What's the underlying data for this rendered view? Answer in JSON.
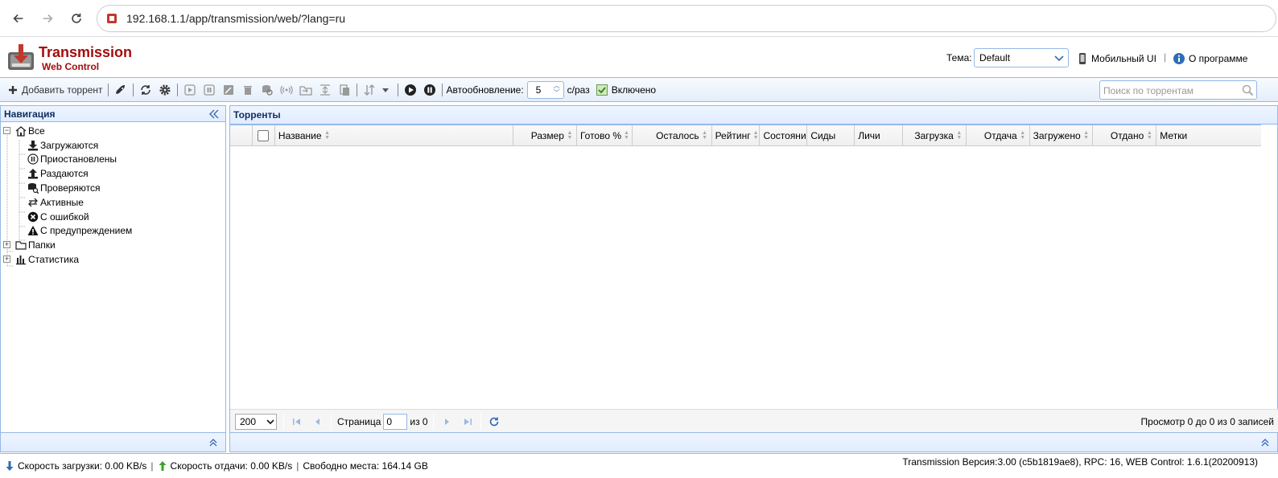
{
  "browser": {
    "url": "192.168.1.1/app/transmission/web/?lang=ru"
  },
  "header": {
    "title": "Transmission",
    "subtitle": "Web Control",
    "theme_label": "Тема:",
    "theme_value": "Default",
    "mobile_label": "Мобильный UI",
    "about_label": "О программе"
  },
  "toolbar": {
    "add_label": "Добавить торрент",
    "autorefresh_label": "Автообновление:",
    "autorefresh_value": "5",
    "autorefresh_unit": "с/раз",
    "enabled_label": "Включено",
    "search_placeholder": "Поиск по торрентам"
  },
  "nav": {
    "title": "Навигация",
    "items": [
      {
        "label": "Все",
        "icon": "home-icon"
      },
      {
        "label": "Загружаются",
        "icon": "download-icon"
      },
      {
        "label": "Приостановлены",
        "icon": "pause-circle-icon"
      },
      {
        "label": "Раздаются",
        "icon": "upload-icon"
      },
      {
        "label": "Проверяются",
        "icon": "database-search-icon"
      },
      {
        "label": "Активные",
        "icon": "arrows-exchange-icon"
      },
      {
        "label": "С ошибкой",
        "icon": "error-circle-icon"
      },
      {
        "label": "С предупреждением",
        "icon": "warning-icon"
      },
      {
        "label": "Папки",
        "icon": "folder-icon"
      },
      {
        "label": "Статистика",
        "icon": "bar-chart-icon"
      }
    ]
  },
  "torrents": {
    "title": "Торренты",
    "columns": [
      "Название",
      "Размер",
      "Готово %",
      "Осталось",
      "Рейтинг",
      "Состояние",
      "Сиды",
      "Личи",
      "Загрузка",
      "Отдача",
      "Загружено",
      "Отдано",
      "Метки"
    ]
  },
  "pager": {
    "page_size": "200",
    "page_label": "Страница",
    "page_value": "0",
    "of_label": "из 0",
    "summary": "Просмотр 0 до 0 из 0 записей"
  },
  "status": {
    "download_speed": "Скорость загрузки: 0.00 KB/s",
    "upload_speed": "Скорость отдачи: 0.00 KB/s",
    "free_space": "Свободно места: 164.14 GB",
    "version": "Transmission Версия:3.00 (c5b1819ae8), RPC: 16, WEB Control: 1.6.1(20200913)"
  },
  "colors": {
    "accent": "#95b8e7",
    "brand": "#a30d0d"
  }
}
